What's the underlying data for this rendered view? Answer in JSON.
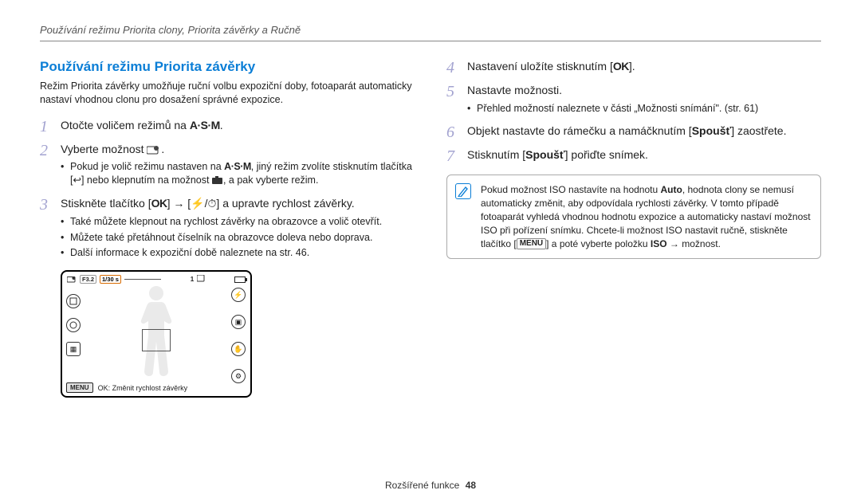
{
  "header": {
    "breadcrumb": "Používání režimu Priorita clony, Priorita závěrky a Ručně"
  },
  "left": {
    "heading": "Používání režimu Priorita závěrky",
    "intro": "Režim Priorita závěrky umožňuje ruční volbu expoziční doby, fotoaparát automaticky nastaví vhodnou clonu pro dosažení správné expozice.",
    "step1": {
      "num": "1",
      "pre": "Otočte voličem režimů na ",
      "mode": "A·S·M",
      "post": "."
    },
    "step2": {
      "num": "2",
      "pre": "Vyberte možnost ",
      "icon_name": "aperture-priority-icon",
      "post": "."
    },
    "step2_sub": {
      "a_pre": "Pokud je volič režimu nastaven na ",
      "a_mode": "A·S·M",
      "a_mid1": ", jiný režim zvolíte stisknutím tlačítka [",
      "a_btn": "↩",
      "a_mid2": "] nebo klepnutím na možnost ",
      "a_icon2_name": "mode-camera-icon",
      "a_post": ", a pak vyberte režim."
    },
    "step3": {
      "num": "3",
      "pre": "Stiskněte tlačítko [",
      "ok": "OK",
      "mid1": "] → [",
      "flash": "⚡",
      "slash": "/",
      "timer": "⏱",
      "mid2": "] a upravte rychlost závěrky."
    },
    "step3_sub": {
      "a": "Také můžete klepnout na rychlost závěrky na obrazovce a volič otevřít.",
      "b": "Můžete také přetáhnout číselník na obrazovce doleva nebo doprava.",
      "c": "Další informace k expoziční době naleznete na str. 46."
    },
    "camera": {
      "f": "F3.2",
      "shutter": "1/30 s",
      "count": "1",
      "menu": "MENU",
      "ok_hint": "OK: Změnit rychlost závěrky"
    }
  },
  "right": {
    "step4": {
      "num": "4",
      "pre": "Nastavení uložíte stisknutím [",
      "ok": "OK",
      "post": "]."
    },
    "step5": {
      "num": "5",
      "text": "Nastavte možnosti."
    },
    "step5_sub": {
      "a": "Přehled možností naleznete v části „Možnosti snímání\". (str. 61)"
    },
    "step6": {
      "num": "6",
      "pre": "Objekt nastavte do rámečku a namáčknutím [",
      "btn": "Spoušť",
      "post": "] zaostřete."
    },
    "step7": {
      "num": "7",
      "pre": "Stisknutím [",
      "btn": "Spoušť",
      "post": "] pořiďte snímek."
    },
    "note": {
      "pre": "Pokud možnost ISO nastavíte na hodnotu ",
      "auto": "Auto",
      "mid1": ", hodnota clony se nemusí automaticky změnit, aby odpovídala rychlosti závěrky. V tomto případě fotoaparát vyhledá vhodnou hodnotu expozice a automaticky nastaví možnost ISO při pořízení snímku. Chcete-li možnost ISO nastavit ručně, stiskněte tlačítko [",
      "menu": "MENU",
      "mid2": "] a poté vyberte položku ",
      "iso": "ISO",
      "post": " → možnost."
    }
  },
  "footer": {
    "section": "Rozšířené funkce",
    "page": "48"
  }
}
